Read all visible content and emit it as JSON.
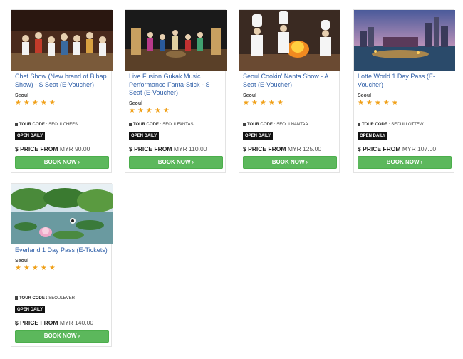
{
  "listing": {
    "tour_code_label": "TOUR CODE :",
    "open_daily_label": "OPEN DAILY",
    "price_from_label": "$ PRICE FROM",
    "book_now_label": "BOOK NOW",
    "star_color": "#f0a018",
    "button_color": "#5cb85c",
    "title_color": "#2f5fa8",
    "items": [
      {
        "title": "Chef Show (New brand of Bibap Show) - S Seat (E-Voucher)",
        "city": "Seoul",
        "rating": 5,
        "stars": "★★★★★",
        "tour_code": "SEOULCHEFS",
        "price": "MYR 90.00",
        "image_icon": "stage-performance-photo"
      },
      {
        "title": "Live Fusion Gukak Music Performance Fanta-Stick - S Seat (E-Voucher)",
        "city": "Seoul",
        "rating": 5,
        "stars": "★★★★★",
        "tour_code": "SEOULFANTAS",
        "price": "MYR 110.00",
        "image_icon": "music-stage-photo"
      },
      {
        "title": "Seoul Cookin' Nanta Show - A Seat (E-Voucher)",
        "city": "Seoul",
        "rating": 5,
        "stars": "★★★★★",
        "tour_code": "SEOULNANTAA",
        "price": "MYR 125.00",
        "image_icon": "chefs-cooking-photo"
      },
      {
        "title": "Lotte World 1 Day Pass (E-Voucher)",
        "city": "Seoul",
        "rating": 5,
        "stars": "★★★★★",
        "tour_code": "SEOULLOTTEW",
        "price": "MYR 107.00",
        "image_icon": "night-city-lake-photo"
      },
      {
        "title": "Everland 1 Day Pass (E-Tickets)",
        "city": "Seoul",
        "rating": 5,
        "stars": "★★★★★",
        "tour_code": "SEOULEVER",
        "price": "MYR 140.00",
        "image_icon": "lotus-garden-photo"
      }
    ]
  }
}
